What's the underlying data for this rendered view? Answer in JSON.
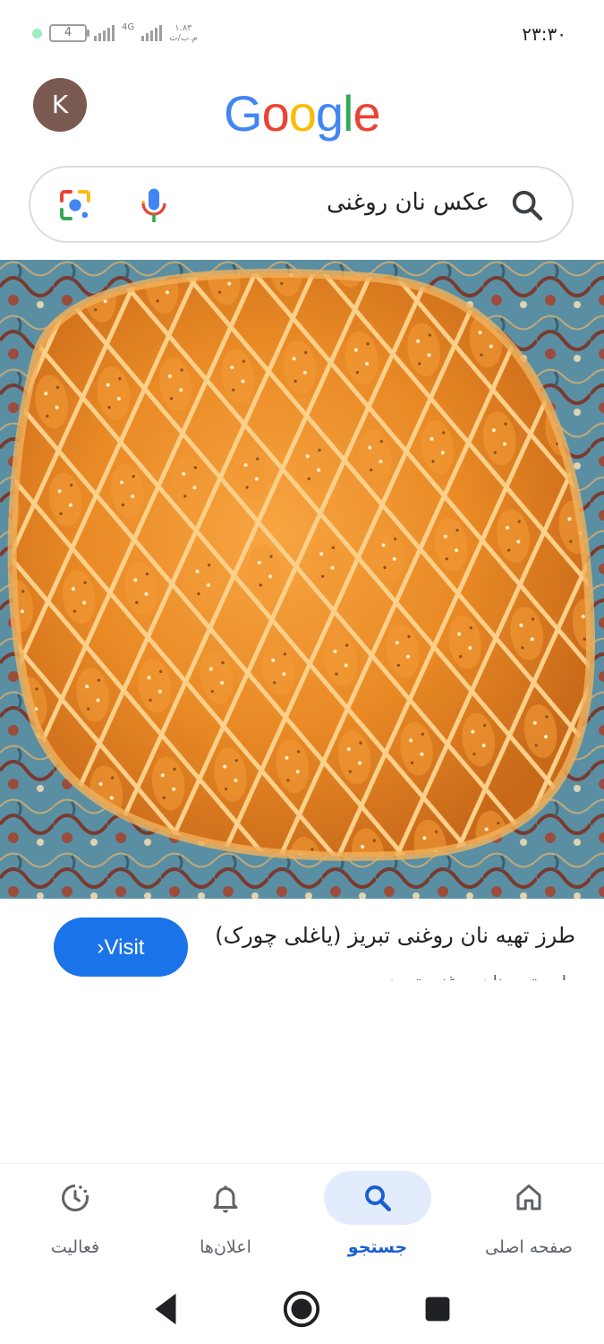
{
  "status_bar": {
    "time": "۲۳:۳۰",
    "battery": "4",
    "network": "4G",
    "speed_value": "۱.۸۳",
    "speed_unit": "م.ب/ث"
  },
  "header": {
    "avatar_initial": "K",
    "logo": [
      "G",
      "o",
      "o",
      "g",
      "l",
      "e"
    ],
    "logo_colors": [
      "#4285F4",
      "#EA4335",
      "#FBBC05",
      "#4285F4",
      "#34A853",
      "#EA4335"
    ]
  },
  "search": {
    "query": "عکس نان روغنی"
  },
  "result": {
    "title": "طرز تهیه نان روغنی تبریز (یاغلی چورک)",
    "subtitle": "طرز تهیه نان روغنی تبریز",
    "visit_label": "Visit"
  },
  "bottom_nav": {
    "items": [
      {
        "label": "فعالیت",
        "icon": "activity-icon",
        "active": false
      },
      {
        "label": "اعلان‌ها",
        "icon": "bell-icon",
        "active": false
      },
      {
        "label": "جستجو",
        "icon": "search-icon",
        "active": true
      },
      {
        "label": "صفحه اصلی",
        "icon": "home-icon",
        "active": false
      }
    ]
  },
  "colors": {
    "accent": "#1a73e8",
    "nav_active_bg": "#e3ecfd",
    "nav_active_text": "#1a5fd0"
  }
}
